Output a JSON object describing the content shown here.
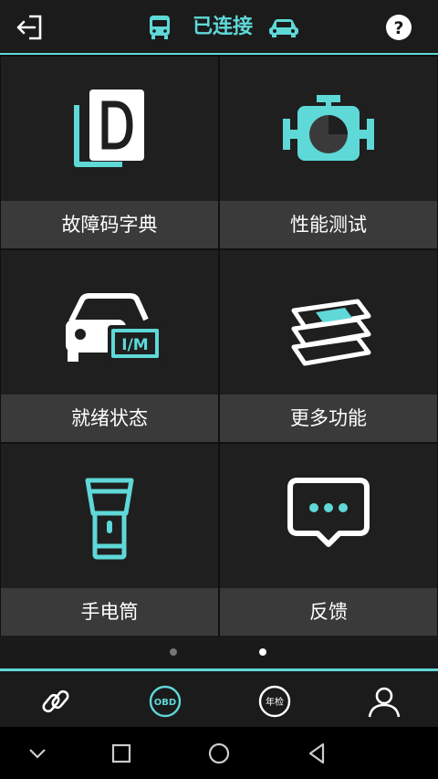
{
  "header": {
    "status_label": "已连接",
    "icons": [
      "exit-icon",
      "bus-icon",
      "car-icon",
      "help-icon"
    ]
  },
  "tiles": [
    {
      "label": "故障码字典",
      "icon": "dtc-dictionary-icon"
    },
    {
      "label": "性能测试",
      "icon": "engine-gauge-icon"
    },
    {
      "label": "就绪状态",
      "icon": "car-im-icon"
    },
    {
      "label": "更多功能",
      "icon": "layers-icon"
    },
    {
      "label": "手电筒",
      "icon": "flashlight-icon"
    },
    {
      "label": "反馈",
      "icon": "chat-bubble-icon"
    }
  ],
  "pager": {
    "count": 2,
    "active_index": 1
  },
  "tabbar": {
    "tabs": [
      {
        "icon": "link-icon",
        "label": ""
      },
      {
        "icon": "obd-icon",
        "label": "OBD"
      },
      {
        "icon": "annual-inspection-icon",
        "label": "年检"
      },
      {
        "icon": "user-icon",
        "label": ""
      }
    ],
    "active_index": 1
  },
  "colors": {
    "accent": "#5fd8d8",
    "tile_bg": "#1f1f1f",
    "caption_bg": "#3a3a3a",
    "background": "#1a1a1a"
  }
}
